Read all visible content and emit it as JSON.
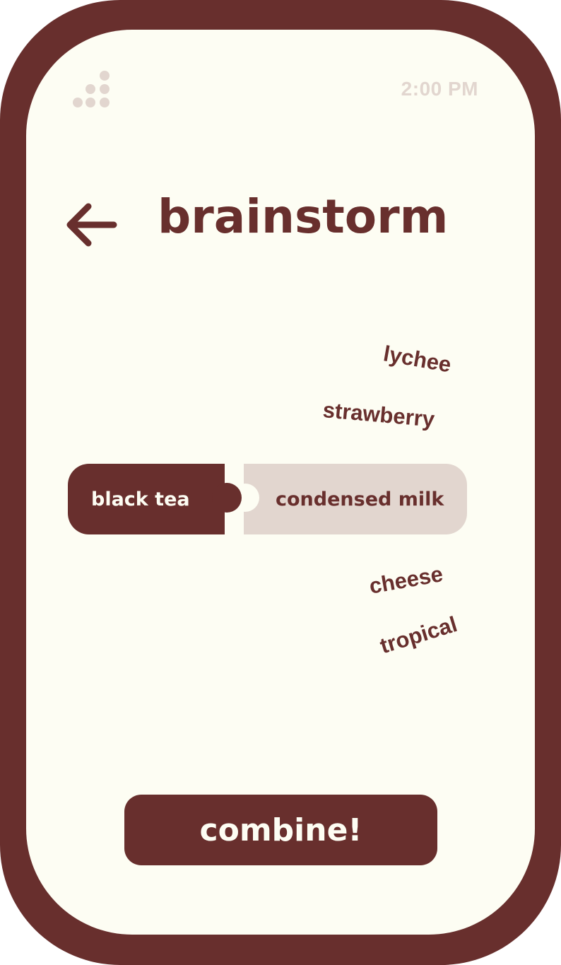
{
  "status_bar": {
    "time": "2:00 PM",
    "signal_icon": "signal-dots-icon"
  },
  "header": {
    "back_icon": "arrow-left-icon",
    "title": "brainstorm"
  },
  "suggestions": [
    "lychee",
    "strawberry",
    "cheese",
    "tropical"
  ],
  "combo": {
    "left": "black tea",
    "right": "condensed milk"
  },
  "actions": {
    "combine_label": "combine!"
  },
  "colors": {
    "frame": "#682f2d",
    "screen": "#fdfdf3",
    "muted": "#e2d6cf",
    "text": "#682f2d"
  }
}
